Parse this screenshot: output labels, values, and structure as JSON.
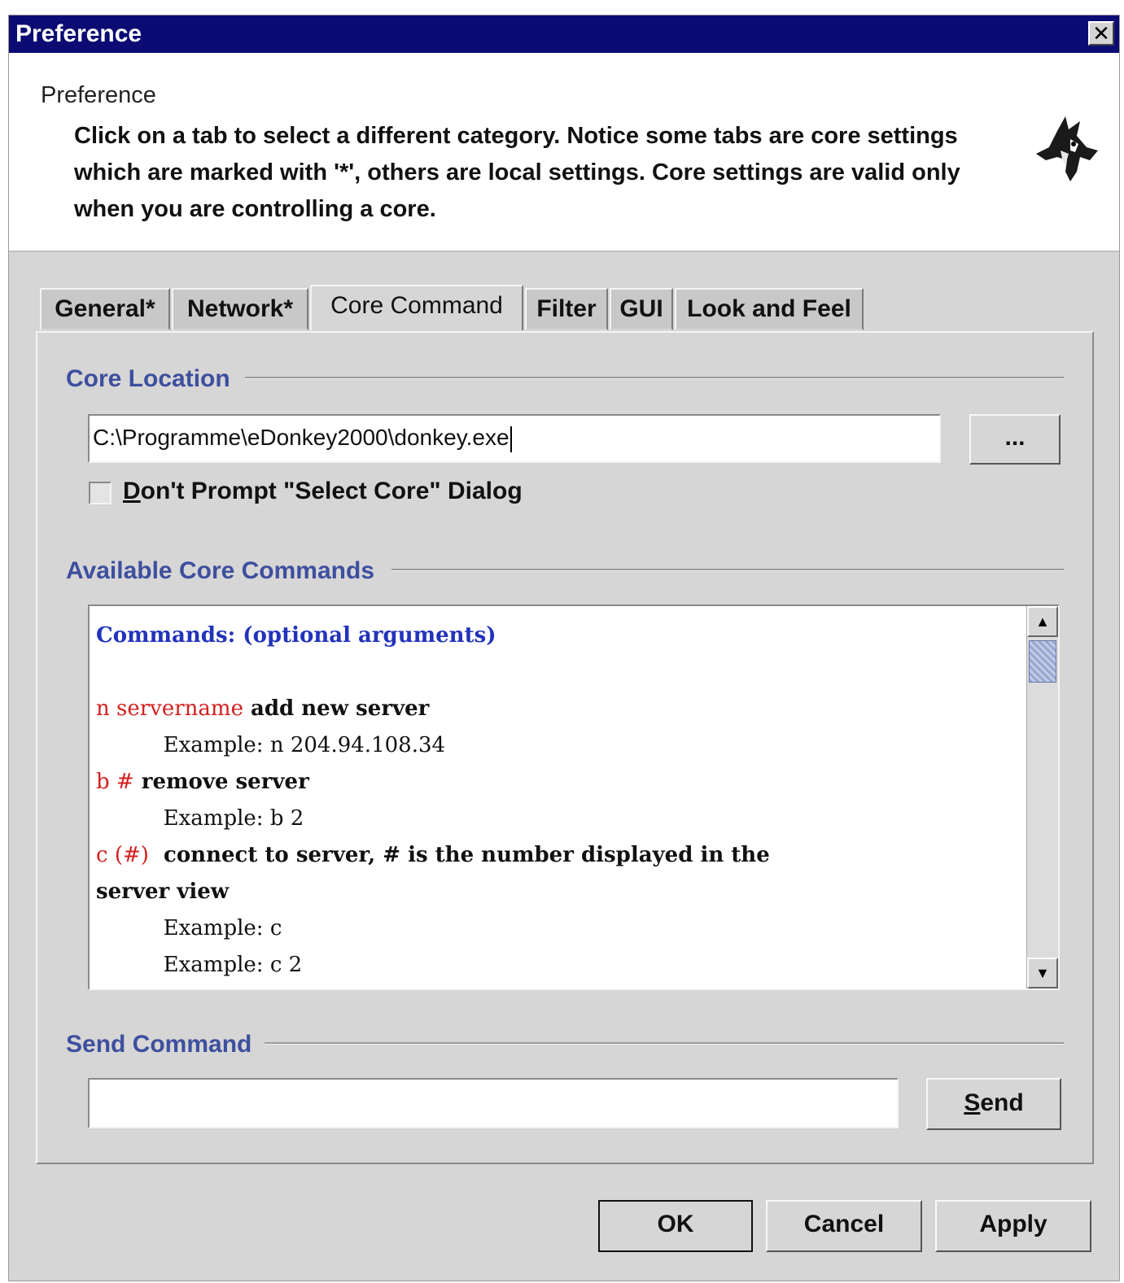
{
  "window": {
    "title": "Preference",
    "close_glyph": "✕"
  },
  "header": {
    "title": "Preference",
    "description": "Click on a tab to select a different category. Notice some tabs are core settings which are marked with '*', others are local settings. Core settings are valid only when you are controlling a core.",
    "logo_icon": "donkey-logo-icon"
  },
  "tabs": [
    {
      "label": "General*",
      "active": false
    },
    {
      "label": "Network*",
      "active": false
    },
    {
      "label": "Core Command",
      "active": true
    },
    {
      "label": "Filter",
      "active": false
    },
    {
      "label": "GUI",
      "active": false
    },
    {
      "label": "Look and Feel",
      "active": false
    }
  ],
  "core_location": {
    "section_title": "Core Location",
    "path_value": "C:\\Programme\\eDonkey2000\\donkey.exe",
    "browse_label": "...",
    "checkbox_label": "Don't Prompt \"Select Core\" Dialog",
    "checkbox_mnemonic": "D",
    "checkbox_rest": "on't Prompt \"Select Core\" Dialog",
    "checkbox_checked": false
  },
  "commands": {
    "section_title": "Available Core Commands",
    "header": "Commands: (optional arguments)",
    "entries": [
      {
        "cmd": "n servername",
        "desc": " add new server",
        "example1": "Example: n 204.94.108.34"
      },
      {
        "cmd": "b #",
        "desc": " remove server",
        "example1": "Example: b 2"
      },
      {
        "cmd": "c (#)",
        "desc": "  connect to server, # is the number displayed in the",
        "desc2": "server view",
        "example1": "Example: c",
        "example2": "Example: c 2"
      }
    ]
  },
  "send": {
    "section_title": "Send Command",
    "input_value": "",
    "button_label": "Send",
    "button_mnemonic": "S",
    "button_rest": "end"
  },
  "footer": {
    "ok_label": "OK",
    "cancel_label": "Cancel",
    "apply_label": "Apply"
  }
}
